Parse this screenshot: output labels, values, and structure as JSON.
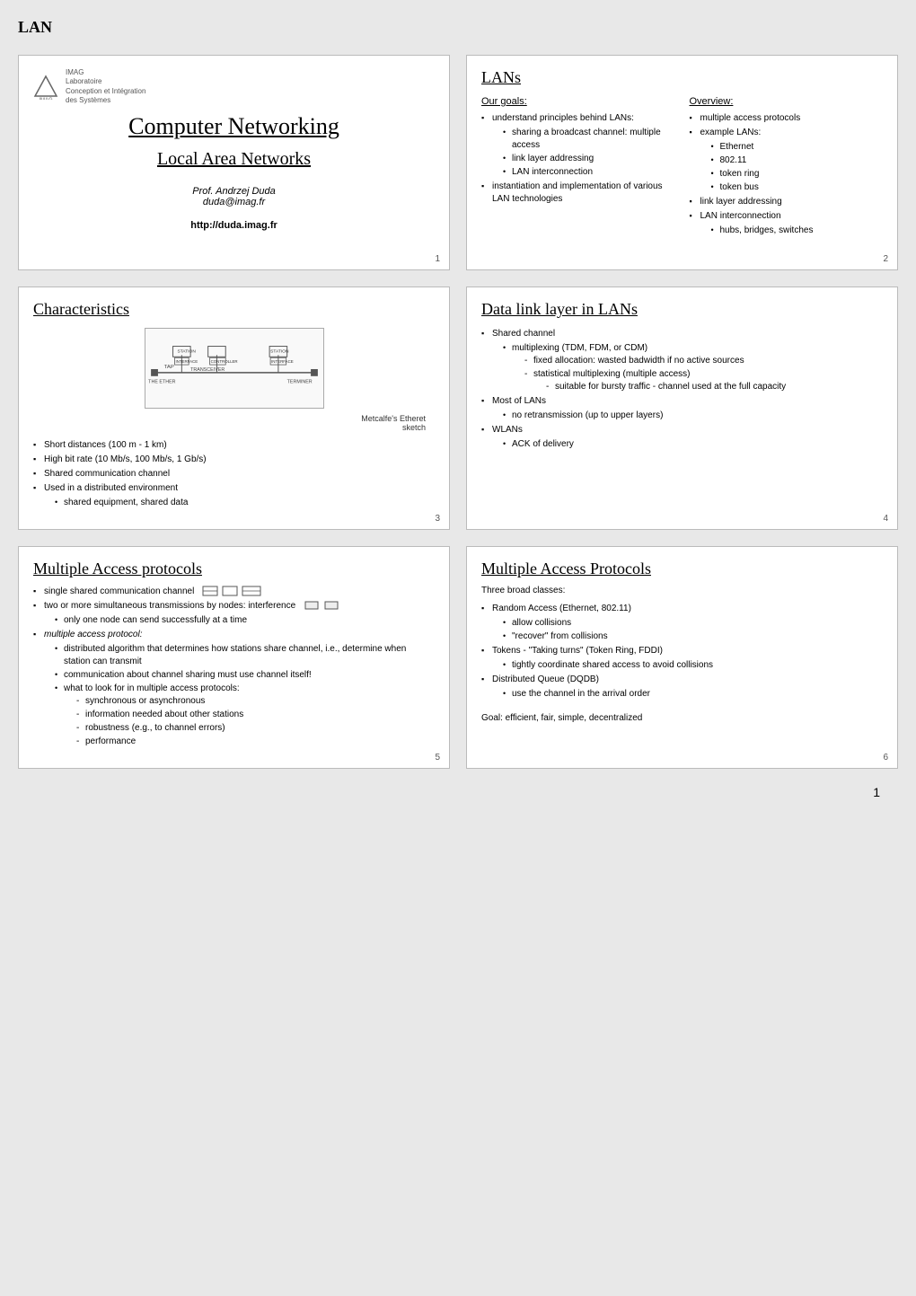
{
  "header": {
    "label": "LAN"
  },
  "slide1": {
    "logo_line1": "IMAG",
    "logo_line2": "Laboratoire\nConception et Intégration\ndes Systèmes",
    "title": "Computer Networking",
    "subtitle": "Local Area Networks",
    "author": "Prof. Andrzej Duda",
    "email": "duda@imag.fr",
    "url": "http://duda.imag.fr",
    "number": "1"
  },
  "slide2": {
    "title": "LANs",
    "goals_header": "Our goals:",
    "overview_header": "Overview:",
    "goals": [
      "understand principles behind LANs:",
      "instantiation and implementation of various LAN technologies"
    ],
    "goals_sub": [
      "sharing a broadcast channel: multiple access",
      "link layer addressing",
      "LAN interconnection"
    ],
    "overview": [
      "multiple access protocols",
      "example LANs:",
      "link layer addressing",
      "LAN interconnection"
    ],
    "overview_sub_lans": [
      "Ethernet",
      "802.11",
      "token ring",
      "token bus"
    ],
    "overview_sub_interconnect": [
      "hubs, bridges, switches"
    ],
    "number": "2"
  },
  "slide3": {
    "title": "Characteristics",
    "diagram_caption": "Metcalfe's Etheret\nsketch",
    "bullets": [
      "Short distances (100 m - 1 km)",
      "High bit rate (10 Mb/s, 100 Mb/s, 1 Gb/s)",
      "Shared communication channel",
      "Used in a distributed environment"
    ],
    "sub_bullets": [
      "shared equipment, shared data"
    ],
    "number": "3"
  },
  "slide4": {
    "title": "Data link layer in LANs",
    "bullets": [
      "Shared channel",
      "Most of LANs",
      "WLANs"
    ],
    "shared_channel_sub": [
      "multiplexing (TDM, FDM, or CDM)"
    ],
    "multiplexing_sub": [
      "fixed allocation: wasted badwidth if no active sources",
      "statistical multiplexing (multiple access)"
    ],
    "statistical_sub": [
      "suitable for bursty traffic - channel used at the full capacity"
    ],
    "most_lans_sub": [
      "no retransmission (up to upper layers)"
    ],
    "wlans_sub": [
      "ACK of delivery"
    ],
    "number": "4"
  },
  "slide5": {
    "title": "Multiple Access protocols",
    "bullets": [
      "single shared communication channel",
      "two or more simultaneous transmissions by nodes: interference",
      "multiple access protocol:"
    ],
    "interference_sub": [
      "only one node can send successfully at a time"
    ],
    "mac_sub": [
      "distributed algorithm that determines how stations share channel, i.e., determine when station can transmit",
      "communication about channel sharing must use channel itself!",
      "what to look for in multiple access protocols:"
    ],
    "mac_sub_sub": [
      "synchronous or asynchronous",
      "information needed about other stations",
      "robustness (e.g., to channel errors)",
      "performance"
    ],
    "number": "5"
  },
  "slide6": {
    "title": "Multiple Access Protocols",
    "intro": "Three broad classes:",
    "bullets": [
      "Random Access (Ethernet, 802.11)",
      "Tokens - \"Taking turns\" (Token Ring, FDDI)",
      "Distributed Queue (DQDB)"
    ],
    "random_sub": [
      "allow collisions",
      "\"recover\" from collisions"
    ],
    "tokens_sub": [
      "tightly coordinate shared access to avoid collisions"
    ],
    "dqdb_sub": [
      "use the channel in the arrival order"
    ],
    "goal": "Goal: efficient, fair, simple, decentralized",
    "number": "6"
  },
  "footer": {
    "page": "1"
  }
}
